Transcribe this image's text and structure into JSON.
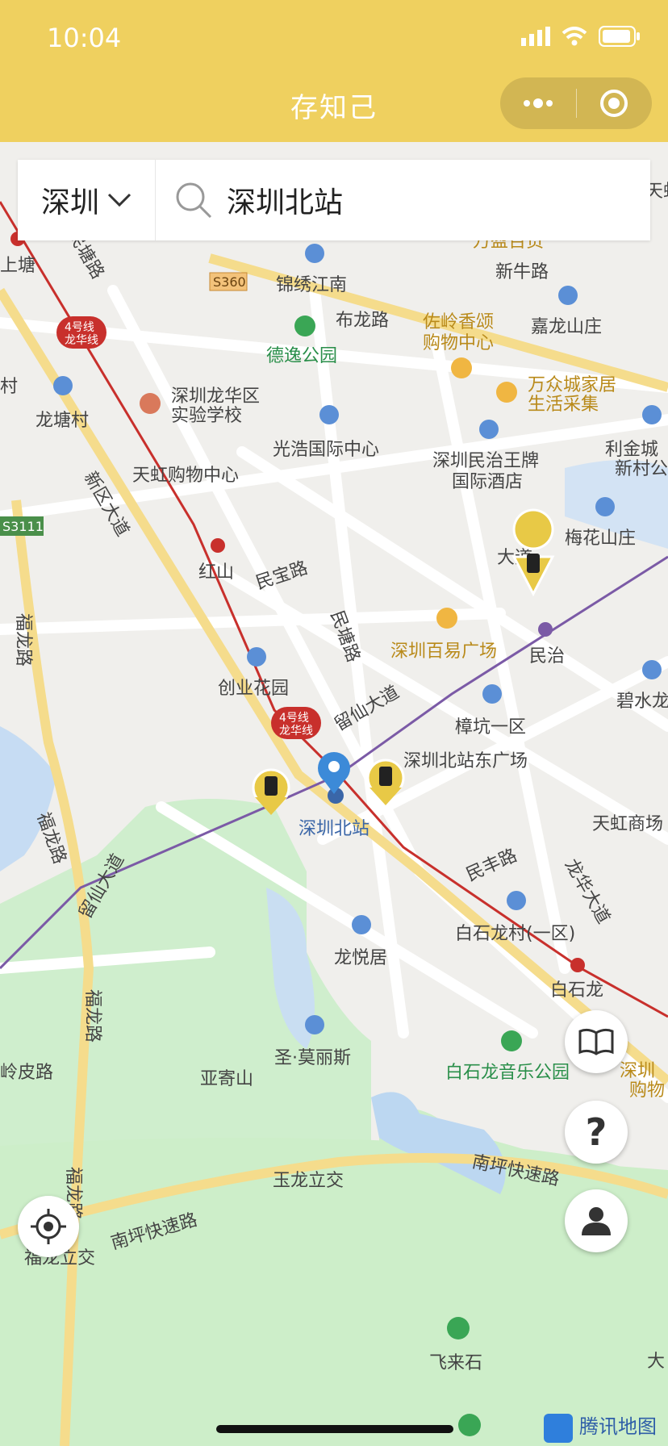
{
  "status": {
    "time": "10:04"
  },
  "header": {
    "title": "存知己"
  },
  "search": {
    "city": "深圳",
    "query": "深圳北站"
  },
  "map": {
    "provider": "腾讯地图",
    "labels": {
      "shangtang": "上塘",
      "jinxiu": "锦绣江南",
      "wanying": "万盈百货",
      "xinniu": "新牛路",
      "shang_edge": "天虹",
      "s360": "S360",
      "bulong": "布龙路",
      "deyi": "德逸公园",
      "zuoling1": "佐岭香颂",
      "zuoling2": "购物中心",
      "jialong": "嘉龙山庄",
      "line4a": "4号线",
      "line4b": "龙华线",
      "longtangroad": "民塘路",
      "school1": "深圳龙华区",
      "school2": "实验学校",
      "wanzhong1": "万众城家居",
      "wanzhong2": "生活采集",
      "cun": "村",
      "longtangcun": "龙塘村",
      "guanghao": "光浩国际中心",
      "minzhi1": "深圳民治王牌",
      "minzhi2": "国际酒店",
      "lijin1": "利金城",
      "lijin2": "新村公",
      "tianhong": "天虹购物中心",
      "s3111": "S3111",
      "xinqu": "新区大道",
      "hongshan": "红山",
      "minbao": "民宝路",
      "meihua": "梅花山庄",
      "dadao": "大道",
      "futian": "福龙路",
      "mintang2": "民塘路",
      "baiyi": "深圳百易广场",
      "minzhi": "民治",
      "chuangye": "创业花园",
      "liuxian": "留仙大道",
      "zhangkeng": "樟坑一区",
      "bishui": "碧水龙",
      "eastsq": "深圳北站东广场",
      "station": "深圳北站",
      "tianhongmall": "天虹商场",
      "liuxian2": "留仙大道",
      "minfeng": "民丰路",
      "longhua": "龙华大道",
      "fulong2": "福龙路",
      "baishilongcun": "白石龙村(一区)",
      "longyue": "龙悦居",
      "baishilong": "白石龙",
      "fulong3": "福龙路",
      "meilifei": "圣·莫丽斯",
      "park": "白石龙音乐公园",
      "shenzhenb": "深圳",
      "gouwu": "购物",
      "lingpi": "岭皮路",
      "yajishan": "亚寄山",
      "yulong": "玉龙立交",
      "nanping": "南坪快速路",
      "nanping2": "南坪快速路",
      "fulong4": "福龙路",
      "fulongli": "福龙立交",
      "feilaishi": "飞来石",
      "da": "大"
    }
  },
  "buttons": {
    "guide": "book-icon",
    "help": "?",
    "profile": "person-icon",
    "locate": "locate-icon"
  },
  "colors": {
    "header": "#efd05f",
    "metro4": "#c8302c",
    "metro_purple": "#7b5aa6",
    "pin": "#3c8ad8"
  }
}
